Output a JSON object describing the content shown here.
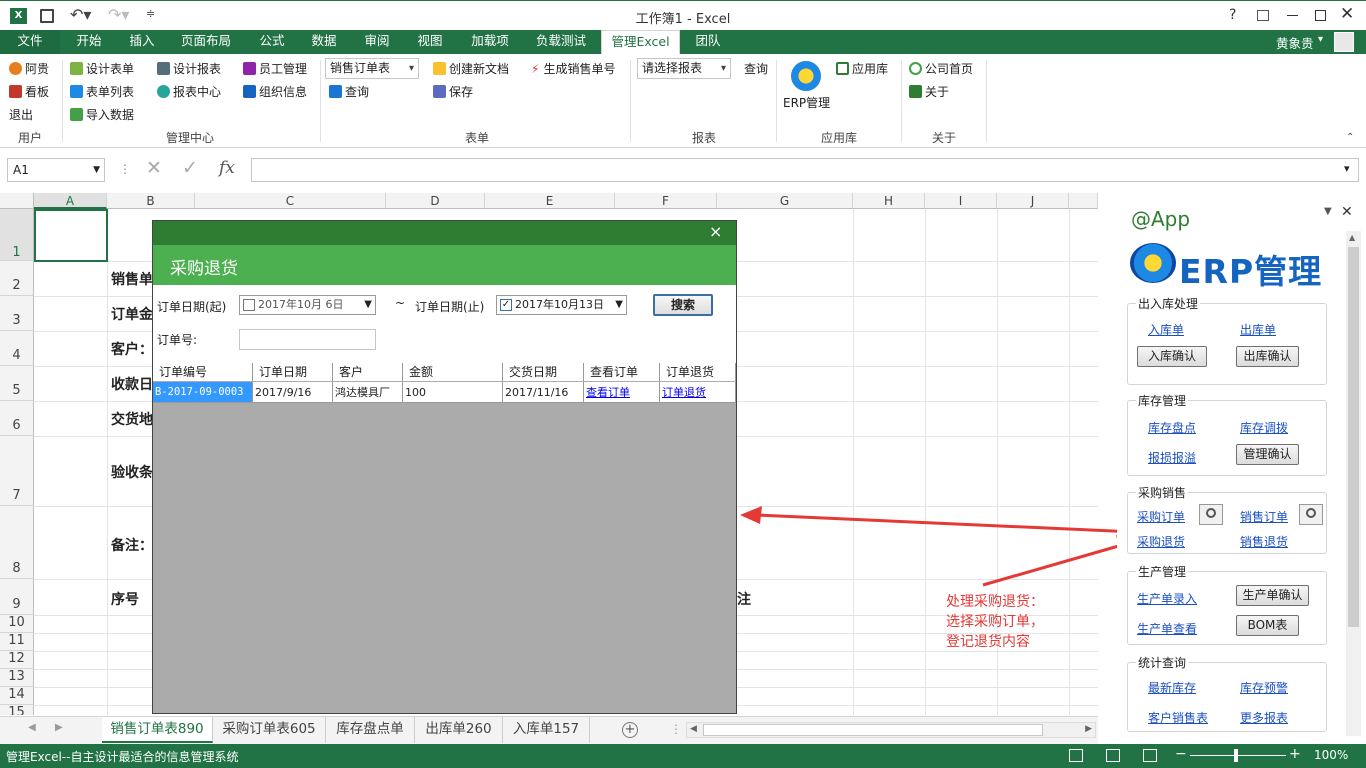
{
  "window": {
    "title": "工作簿1 - Excel",
    "help": "?",
    "user": "黄象贵"
  },
  "ribbon_tabs": [
    "文件",
    "开始",
    "插入",
    "页面布局",
    "公式",
    "数据",
    "审阅",
    "视图",
    "加载项",
    "负载测试",
    "管理Excel",
    "团队"
  ],
  "ribbon": {
    "user_group": {
      "items": [
        "阿贵",
        "看板",
        "退出"
      ],
      "label": "用户"
    },
    "mgmt_group": {
      "items": [
        "设计表单",
        "表单列表",
        "导入数据",
        "设计报表",
        "报表中心",
        "员工管理",
        "组织信息"
      ],
      "label": "管理中心"
    },
    "form_group": {
      "select": "销售订单表",
      "query": "查询",
      "new_doc": "创建新文档",
      "save": "保存",
      "gen_no": "生成销售单号",
      "label": "表单"
    },
    "report_group": {
      "select": "请选择报表",
      "query": "查询",
      "label": "报表"
    },
    "app_group": {
      "erp": "ERP管理",
      "apps": "应用库",
      "label": "应用库"
    },
    "about_group": {
      "home": "公司首页",
      "about": "关于",
      "label": "关于"
    }
  },
  "formula_bar": {
    "name_box": "A1",
    "fx": "fx"
  },
  "grid": {
    "columns": [
      "A",
      "B",
      "C",
      "D",
      "E",
      "F",
      "G",
      "H",
      "I",
      "J"
    ],
    "rows": [
      "1",
      "2",
      "3",
      "4",
      "5",
      "6",
      "7",
      "8",
      "9",
      "10",
      "11",
      "12",
      "13",
      "14",
      "15"
    ],
    "cells": {
      "b2": "销售单",
      "b3": "订单金",
      "b4": "客户：",
      "b5": "收款日",
      "b6": "交货地",
      "b7": "验收条",
      "b8": "备注：",
      "b9": "序号",
      "g9": "注"
    }
  },
  "dialog": {
    "title": "采购退货",
    "close": "×",
    "date_from_label": "订单日期(起)",
    "date_from_value": "2017年10月 6日",
    "tilde": "~",
    "date_to_label": "订单日期(止)",
    "date_to_value": "2017年10月13日",
    "search_btn": "搜索",
    "order_no_label": "订单号:",
    "order_no_value": "",
    "headers": [
      "订单编号",
      "订单日期",
      "客户",
      "金额",
      "交货日期",
      "查看订单",
      "订单退货"
    ],
    "row": [
      "B-2017-09-0003",
      "2017/9/16",
      "鸿达模具厂",
      "100",
      "2017/11/16",
      "查看订单",
      "订单退货"
    ]
  },
  "pane": {
    "title": "@App",
    "logo_text": "ERP管理",
    "s1": {
      "title": "出入库处理",
      "link1": "入库单",
      "link2": "出库单",
      "btn1": "入库确认",
      "btn2": "出库确认"
    },
    "s2": {
      "title": "库存管理",
      "link1": "库存盘点",
      "link2": "库存调拨",
      "link3": "报损报溢",
      "btn1": "管理确认"
    },
    "s3": {
      "title": "采购销售",
      "link1": "采购订单",
      "link2": "销售订单",
      "link3": "采购退货",
      "link4": "销售退货"
    },
    "s4": {
      "title": "生产管理",
      "link1": "生产单录入",
      "link2": "生产单查看",
      "btn1": "生产单确认",
      "btn2": "BOM表"
    },
    "s5": {
      "title": "统计查询",
      "link1": "最新库存",
      "link2": "库存预警",
      "link3": "客户销售表",
      "link4": "更多报表"
    }
  },
  "annotation": {
    "line1": "处理采购退货：",
    "line2": "选择采购订单，",
    "line3": "登记退货内容"
  },
  "sheet_tabs": [
    "销售订单表890",
    "采购订单表605",
    "库存盘点单",
    "出库单260",
    "入库单157"
  ],
  "status": {
    "text": "管理Excel--自主设计最适合的信息管理系统",
    "zoom": "100%"
  },
  "colors": {
    "excel_green": "#217346",
    "dialog_green": "#4caf50",
    "annotation_red": "#e53935"
  }
}
